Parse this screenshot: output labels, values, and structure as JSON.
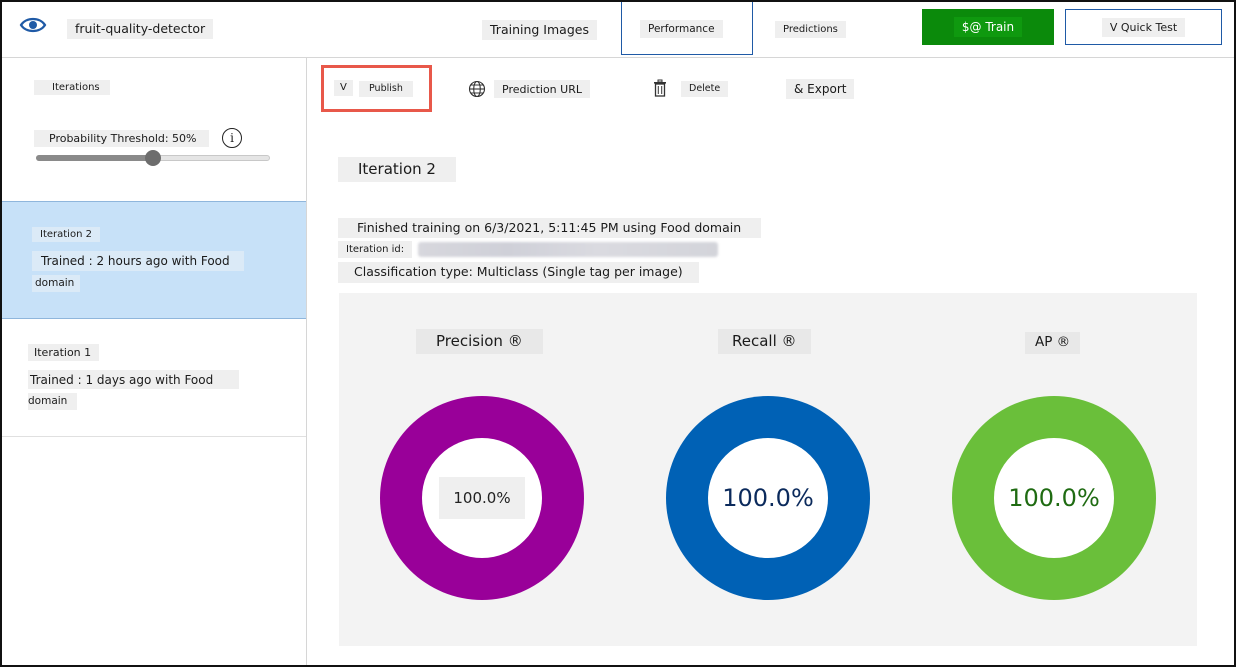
{
  "header": {
    "project_name": "fruit-quality-detector",
    "tabs": [
      {
        "label": "Training Images"
      },
      {
        "label": "Performance",
        "active": true
      },
      {
        "label": "Predictions"
      }
    ],
    "train_label": "$@ Train",
    "quick_test_label": "V Quick Test"
  },
  "sidebar": {
    "iterations_label": "Iterations",
    "threshold_label": "Probability Threshold: 50%",
    "threshold_value": 0.5,
    "info_glyph": "i",
    "items": [
      {
        "title": "Iteration 2",
        "trained": "Trained : 2 hours ago with Food",
        "domain": "domain",
        "selected": true
      },
      {
        "title": "Iteration 1",
        "trained": "Trained : 1 days ago with Food",
        "domain": "domain",
        "selected": false
      }
    ]
  },
  "toolbar": {
    "publish_prefix": "V",
    "publish": "Publish",
    "prediction_url": "Prediction URL",
    "delete": "Delete",
    "export": "& Export"
  },
  "main": {
    "iteration_title": "Iteration 2",
    "finished": "Finished training on 6/3/2021, 5:11:45 PM using Food domain",
    "iteration_id_label": "Iteration id:",
    "classification": "Classification type: Multiclass (Single tag per image)"
  },
  "metrics": [
    {
      "label": "Precision ®",
      "value": "100.0%",
      "color": "#990099",
      "text_color": "#222222"
    },
    {
      "label": "Recall ®",
      "value": "100.0%",
      "color": "#0061b5",
      "text_color": "#0b2a5c"
    },
    {
      "label": "AP ®",
      "value": "100.0%",
      "color": "#6abf3a",
      "text_color": "#1f6b12"
    }
  ],
  "colors": {
    "accent": "#1f5aa6",
    "train_button": "#0b8a0b",
    "selected_iteration": "#c7e1f8",
    "publish_highlight": "#e8584a"
  },
  "icons": [
    "eye-icon",
    "info-icon",
    "globe-icon",
    "trash-icon"
  ]
}
